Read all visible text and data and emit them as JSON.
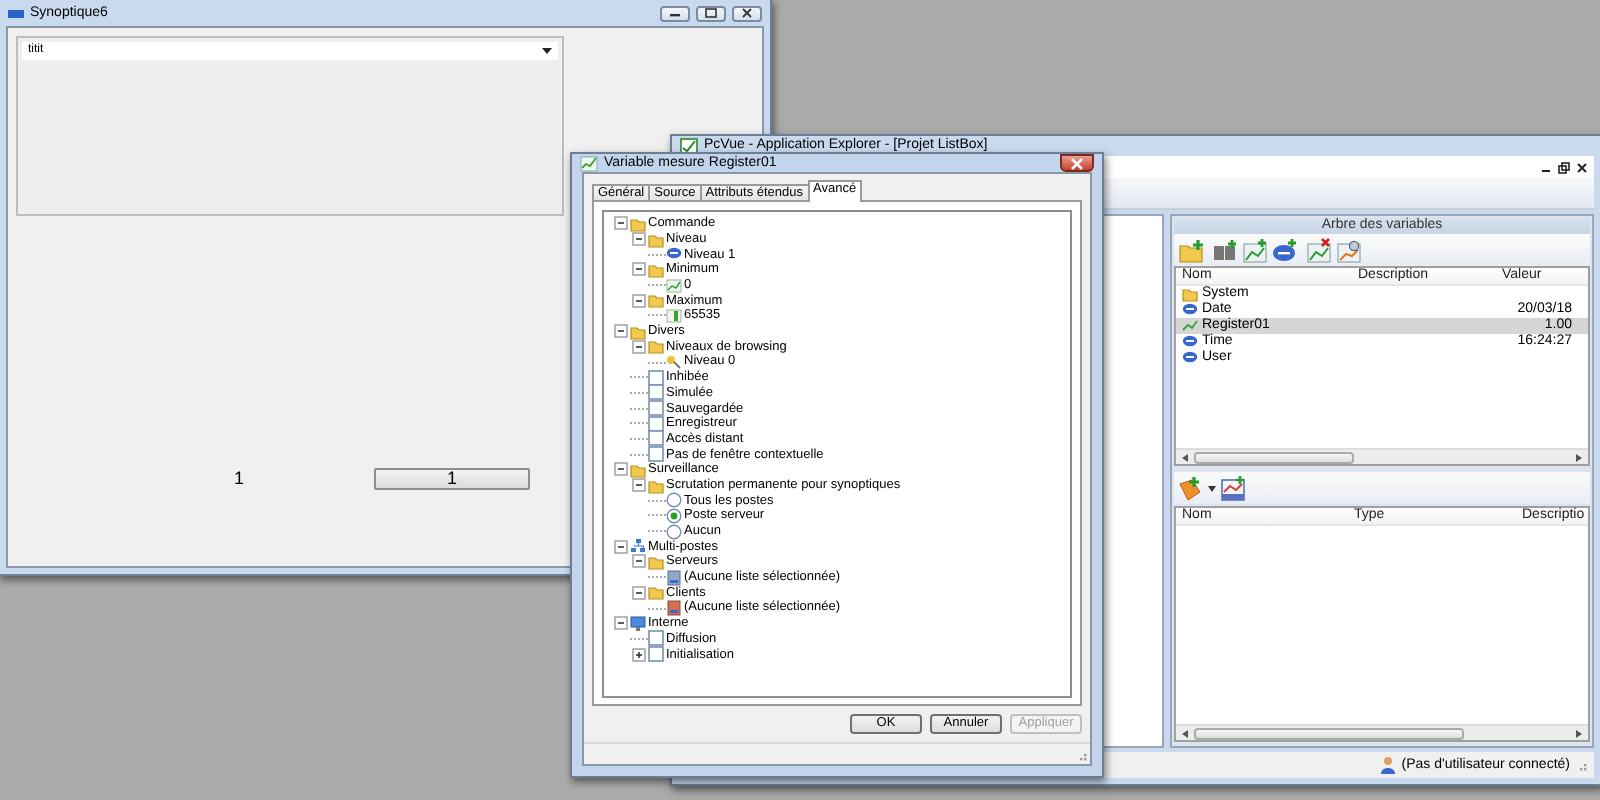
{
  "synoptic_window": {
    "title": "Synoptique6",
    "dropdown": {
      "value": "titit"
    },
    "label": "1",
    "button": "1"
  },
  "explorer_window": {
    "title": "PcVue - Application Explorer - [Projet ListBox]",
    "variable_tree": {
      "title": "Arbre des variables",
      "columns": [
        "Nom",
        "Description",
        "Valeur"
      ],
      "rows": [
        {
          "name": "System",
          "kind": "folder",
          "selected": false
        },
        {
          "name": "Date",
          "kind": "text",
          "value": "20/03/18",
          "selected": false
        },
        {
          "name": "Register01",
          "kind": "register",
          "value": "1.00",
          "selected": true
        },
        {
          "name": "Time",
          "kind": "text",
          "value": "16:24:27",
          "selected": false
        },
        {
          "name": "User",
          "kind": "text",
          "selected": false
        }
      ]
    },
    "lower_list": {
      "columns": [
        "Nom",
        "Type",
        "Descriptio"
      ]
    },
    "status_bar": "(Pas d'utilisateur connecté)"
  },
  "dialog": {
    "title": "Variable mesure Register01",
    "tabs": [
      {
        "label": "Général",
        "selected": false
      },
      {
        "label": "Source",
        "selected": false
      },
      {
        "label": "Attributs étendus",
        "selected": false
      },
      {
        "label": "Avancé",
        "selected": true
      }
    ],
    "tree": [
      {
        "label": "Commande",
        "kind": "folder",
        "expanded": true,
        "children": [
          {
            "label": "Niveau",
            "kind": "folder",
            "expanded": true,
            "children": [
              {
                "label": "Niveau 1",
                "kind": "level"
              }
            ]
          },
          {
            "label": "Minimum",
            "kind": "folder",
            "expanded": true,
            "children": [
              {
                "label": "0",
                "kind": "value"
              }
            ]
          },
          {
            "label": "Maximum",
            "kind": "folder",
            "expanded": true,
            "children": [
              {
                "label": "65535",
                "kind": "bar"
              }
            ]
          }
        ]
      },
      {
        "label": "Divers",
        "kind": "folder",
        "expanded": true,
        "children": [
          {
            "label": "Niveaux de browsing",
            "kind": "folder",
            "expanded": true,
            "children": [
              {
                "label": "Niveau 0",
                "kind": "key"
              }
            ]
          },
          {
            "label": "Inhibée",
            "kind": "checkbox",
            "checked": false
          },
          {
            "label": "Simulée",
            "kind": "checkbox",
            "checked": false
          },
          {
            "label": "Sauvegardée",
            "kind": "checkbox",
            "checked": false
          },
          {
            "label": "Enregistreur",
            "kind": "checkbox",
            "checked": false
          },
          {
            "label": "Accès distant",
            "kind": "checkbox",
            "checked": false
          },
          {
            "label": "Pas de fenêtre contextuelle",
            "kind": "checkbox",
            "checked": false
          }
        ]
      },
      {
        "label": "Surveillance",
        "kind": "folder",
        "expanded": true,
        "children": [
          {
            "label": "Scrutation permanente pour synoptiques",
            "kind": "folder",
            "expanded": true,
            "children": [
              {
                "label": "Tous les postes",
                "kind": "radio",
                "selected": false
              },
              {
                "label": "Poste serveur",
                "kind": "radio",
                "selected": true
              },
              {
                "label": "Aucun",
                "kind": "radio",
                "selected": false
              }
            ]
          }
        ]
      },
      {
        "label": "Multi-postes",
        "kind": "network",
        "expanded": true,
        "children": [
          {
            "label": "Serveurs",
            "kind": "folder",
            "expanded": true,
            "children": [
              {
                "label": "(Aucune liste sélectionnée)",
                "kind": "server"
              }
            ]
          },
          {
            "label": "Clients",
            "kind": "folder",
            "expanded": true,
            "children": [
              {
                "label": "(Aucune liste sélectionnée)",
                "kind": "client"
              }
            ]
          }
        ]
      },
      {
        "label": "Interne",
        "kind": "monitor",
        "expanded": true,
        "children": [
          {
            "label": "Diffusion",
            "kind": "checkbox",
            "checked": false
          },
          {
            "label": "Initialisation",
            "kind": "checkbox",
            "checked": false,
            "expanded": false
          }
        ]
      }
    ],
    "buttons": [
      {
        "label": "OK",
        "disabled": false
      },
      {
        "label": "Annuler",
        "disabled": false
      },
      {
        "label": "Appliquer",
        "disabled": true
      }
    ]
  }
}
